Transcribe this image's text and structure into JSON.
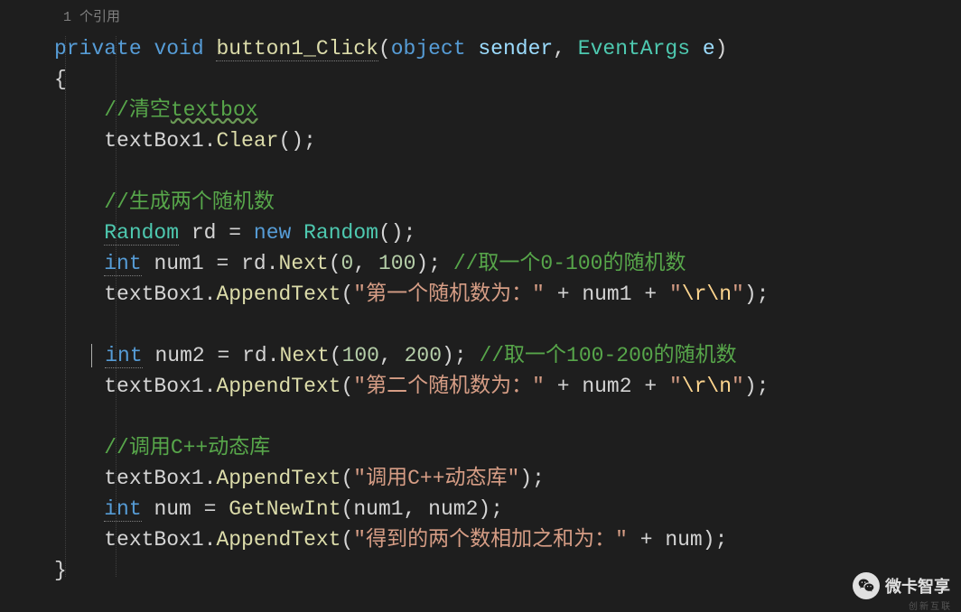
{
  "ref": "1 个引用",
  "kw": {
    "private": "private",
    "void": "void",
    "object": "object",
    "new": "new",
    "int": "int"
  },
  "ty": {
    "EventArgs": "EventArgs",
    "Random": "Random"
  },
  "mth": {
    "btn": "button1_Click",
    "clear": "Clear",
    "next": "Next",
    "append": "AppendText",
    "getnew": "GetNewInt"
  },
  "id": {
    "sender": "sender",
    "e": "e",
    "tb": "textBox1",
    "rd": "rd",
    "n1": "num1",
    "n2": "num2",
    "n": "num"
  },
  "cm": {
    "c1": "//清空",
    "c1b": "textbox",
    "c2": "//生成两个随机数",
    "c3": "//取一个0-100的随机数",
    "c4": "//取一个100-200的随机数",
    "c5": "//调用C++动态库"
  },
  "str": {
    "s1": "\"第一个随机数为：\"",
    "s2": "\"第二个随机数为：\"",
    "s3": "\"调用C++动态库\"",
    "s4": "\"得到的两个数相加之和为：\""
  },
  "esc": {
    "q": "\"",
    "rn": "\\r\\n"
  },
  "num": {
    "z": "0",
    "h": "100",
    "th": "200"
  },
  "pun": {
    "lp": "(",
    "rp": ")",
    "lb": "{",
    "rb": "}",
    "sc": ";",
    "cm": ", ",
    "eq": " = ",
    "dot": ".",
    "plus": " + ",
    "sp": " "
  },
  "watermark": "微卡智享",
  "wm2": "创新互联"
}
